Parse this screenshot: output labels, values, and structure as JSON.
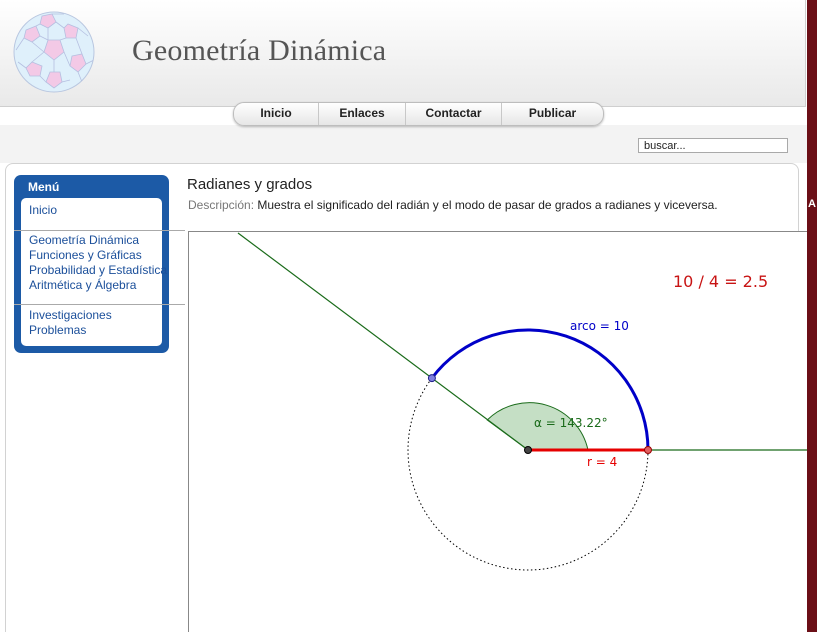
{
  "site": {
    "title": "Geometría Dinámica"
  },
  "nav": [
    {
      "label": "Inicio"
    },
    {
      "label": "Enlaces"
    },
    {
      "label": "Contactar"
    },
    {
      "label": "Publicar"
    }
  ],
  "search": {
    "value": "buscar..."
  },
  "menu": {
    "title": "Menú",
    "items": [
      {
        "label": "Inicio"
      },
      {
        "label": "Geometría Dinámica"
      },
      {
        "label": "Funciones y Gráficas"
      },
      {
        "label": "Probabilidad y Estadística"
      },
      {
        "label": "Aritmética y Álgebra"
      },
      {
        "label": "Investigaciones"
      },
      {
        "label": "Problemas"
      }
    ]
  },
  "article": {
    "title": "Radianes y grados",
    "description_label": "Descripción:",
    "description": "Muestra el significado del radián y el modo de pasar de grados a radianes y viceversa."
  },
  "applet": {
    "ratio_text": "10 / 4 = 2.5",
    "arc_label": "arco = 10",
    "angle_label": "α = 143.22°",
    "radius_label": "r = 4",
    "colors": {
      "arc": "#0000c8",
      "radius": "#e60000",
      "angle_fill": "#2e8b2e",
      "lines": "#1a6b1a",
      "ratio": "#c81414"
    }
  },
  "colors": {
    "menu_bg": "#1c5aa6",
    "link": "#1b4f9a",
    "outer_bg": "#6b0f17"
  },
  "right_edge_letter": "A"
}
